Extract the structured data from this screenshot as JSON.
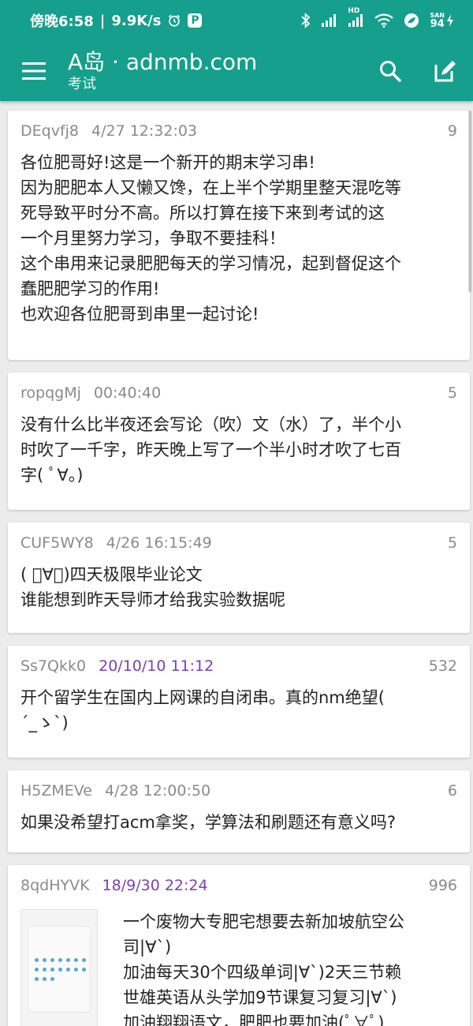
{
  "status_bar": {
    "time": "傍晚6:58",
    "net_speed": "9.9K/s",
    "signal_label": "HD",
    "battery_top": "SAN",
    "battery_level": "94"
  },
  "toolbar": {
    "title": "A岛 · adnmb.com",
    "subtitle": "考试"
  },
  "icons": {
    "menu": "menu-icon",
    "search": "search-icon",
    "compose": "compose-icon"
  },
  "colors": {
    "primary": "#159f8c",
    "accent_purple": "#7b3fb5"
  },
  "threads": [
    {
      "uid": "DEqvfj8",
      "time": "4/27 12:32:03",
      "count": "9",
      "lines": [
        "各位肥哥好!这是一个新开的期末学习串!",
        "因为肥肥本人又懒又馋，在上半个学期里整天混吃等",
        "死导致平时分不高。所以打算在接下来到考试的这",
        "一个月里努力学习，争取不要挂科！",
        "这个串用来记录肥肥每天的学习情况，起到督促这个",
        "蠢肥肥学习的作用!",
        "也欢迎各位肥哥到串里一起讨论!"
      ]
    },
    {
      "uid": "ropqgMj",
      "time": "00:40:40",
      "count": "5",
      "lines": [
        "没有什么比半夜还会写论（吹）文（水）了，半个小",
        "时吹了一千字，昨天晚上写了一个半小时才吹了七百",
        "字( ﾟ∀。)"
      ]
    },
    {
      "uid": "CUF5WY8",
      "time": "4/26 16:15:49",
      "count": "5",
      "lines": [
        "( ﾟ∀。)四天极限毕业论文",
        "谁能想到昨天导师才给我实验数据呢"
      ]
    },
    {
      "uid": "Ss7Qkk0",
      "time": "20/10/10 11:12",
      "count": "532",
      "lines": [
        "开个留学生在国内上网课的自闭串。真的nm绝望(",
        "´_ゝ`)"
      ]
    },
    {
      "uid": "H5ZMEVe",
      "time": "4/28 12:00:50",
      "count": "6",
      "lines": [
        "如果没希望打acm拿奖，学算法和刷题还有意义吗?"
      ]
    },
    {
      "uid": "8qdHYVK",
      "time": "18/9/30 22:24",
      "count": "996",
      "lines": [
        "一个废物大专肥宅想要去新加坡航空公",
        "司|∀`)",
        "加油每天30个四级单词|∀`)2天三节赖",
        "世雄英语从头学加9节课复习复习|∀`)",
        "加油翔翔语文，肥肥也要加油(ﾟ∀ﾟ)"
      ]
    }
  ]
}
